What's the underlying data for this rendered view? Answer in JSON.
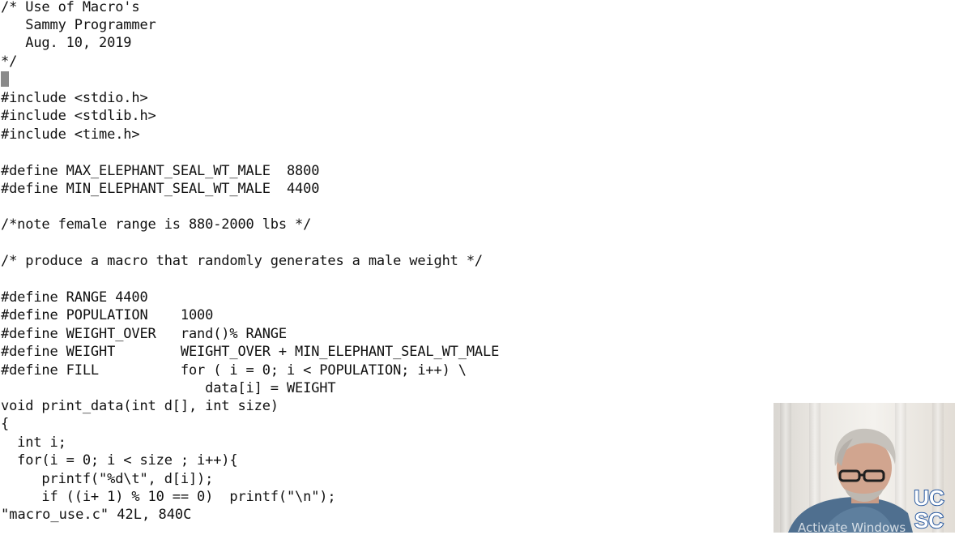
{
  "editor": {
    "lines": [
      "/* Use of Macro's",
      "   Sammy Programmer",
      "   Aug. 10, 2019",
      "*/",
      "",
      "#include <stdio.h>",
      "#include <stdlib.h>",
      "#include <time.h>",
      "",
      "#define MAX_ELEPHANT_SEAL_WT_MALE  8800",
      "#define MIN_ELEPHANT_SEAL_WT_MALE  4400",
      "",
      "/*note female range is 880-2000 lbs */",
      "",
      "/* produce a macro that randomly generates a male weight */",
      "",
      "#define RANGE 4400",
      "#define POPULATION    1000",
      "#define WEIGHT_OVER   rand()% RANGE",
      "#define WEIGHT        WEIGHT_OVER + MIN_ELEPHANT_SEAL_WT_MALE",
      "#define FILL          for ( i = 0; i < POPULATION; i++) \\",
      "                         data[i] = WEIGHT",
      "void print_data(int d[], int size)",
      "{",
      "  int i;",
      "  for(i = 0; i < size ; i++){",
      "     printf(\"%d\\t\", d[i]);",
      "     if ((i+ 1) % 10 == 0)  printf(\"\\n\");"
    ],
    "status": "\"macro_use.c\" 42L, 840C"
  },
  "webcam": {
    "logo_top": "UC",
    "logo_bottom": "SC"
  },
  "overlay": {
    "watermark": "Activate Windows"
  },
  "colors": {
    "text": "#111111",
    "background": "#ffffff",
    "cursor": "#8a8a8a",
    "logo_blue": "#2a5aa0"
  }
}
